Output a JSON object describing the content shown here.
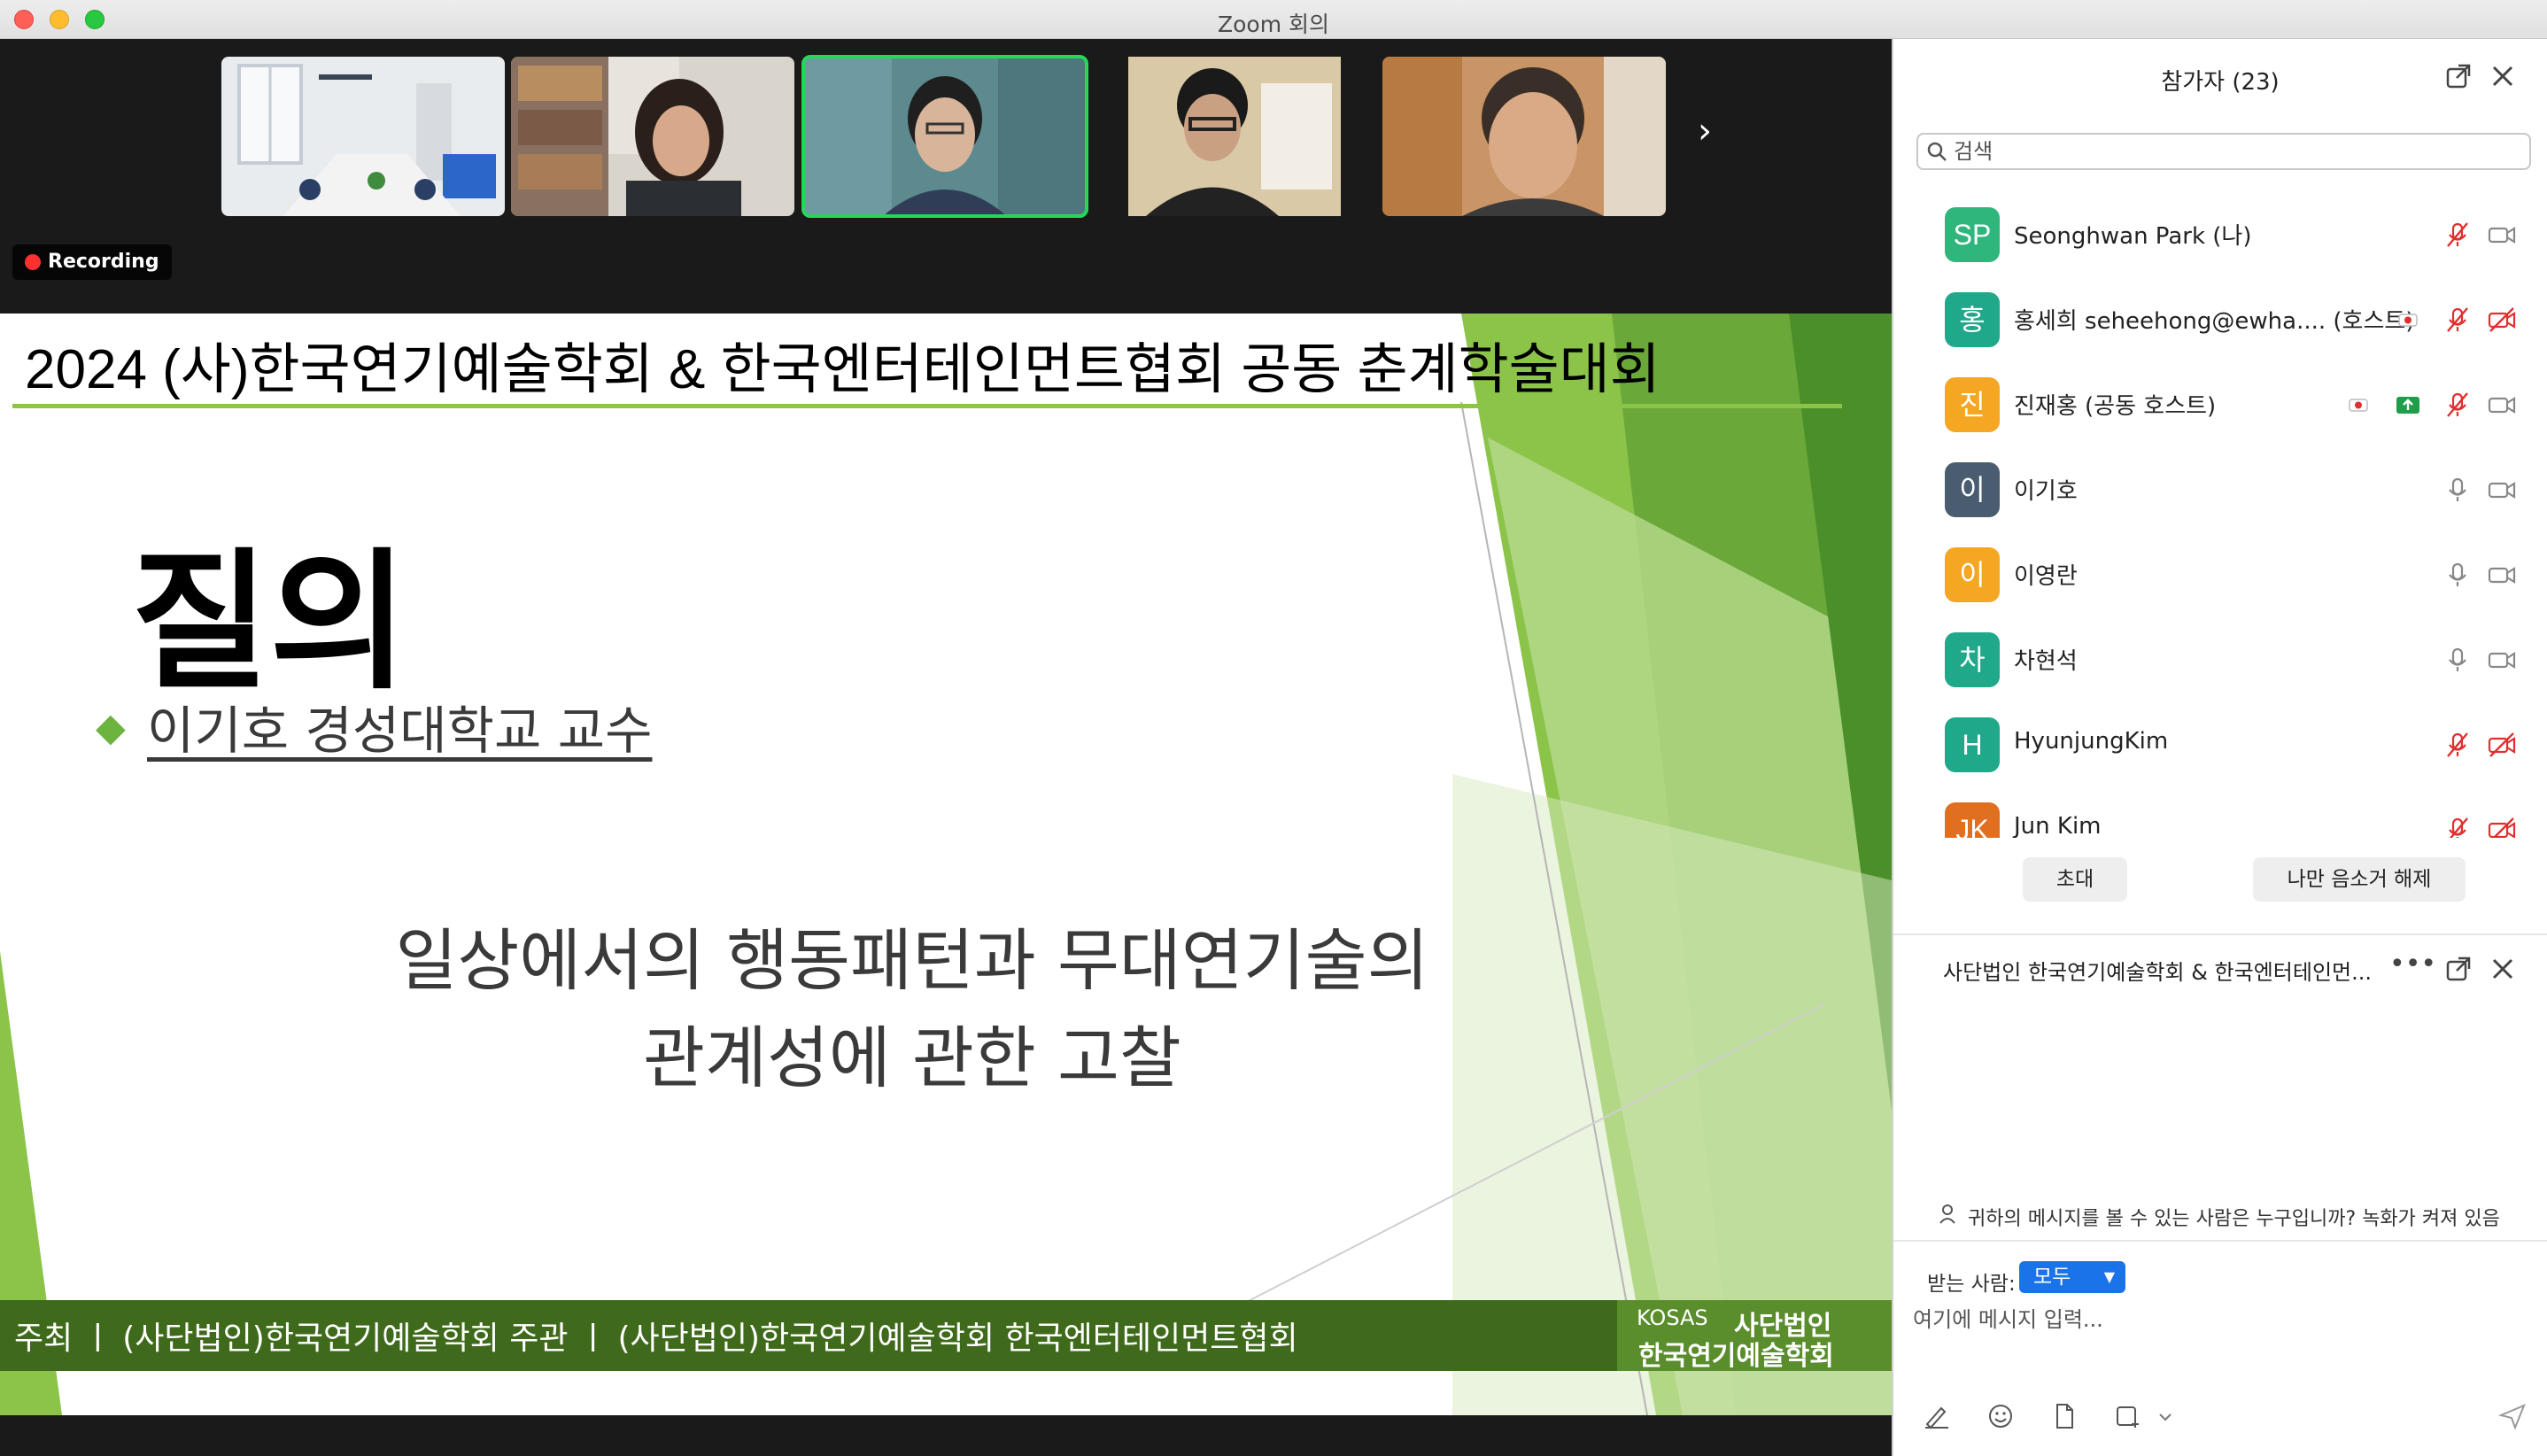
{
  "window": {
    "title": "Zoom 회의"
  },
  "video_strip": {
    "tiles": [
      {
        "name": "room-camera"
      },
      {
        "name": "participant-woman"
      },
      {
        "name": "participant-active-speaker"
      },
      {
        "name": "participant-glasses"
      },
      {
        "name": "participant-man"
      }
    ],
    "next_icon": "chevron-right-icon"
  },
  "recording": {
    "label": "Recording",
    "color": "#ff3030"
  },
  "slide": {
    "header": "2024 (사)한국연기예술학회 & 한국엔터테인먼트협회 공동 춘계학술대회",
    "big_title": "질의",
    "bullet": "◆",
    "presenter": "이기호 경성대학교 교수",
    "topic_line1": "일상에서의 행동패턴과 무대연기술의",
    "topic_line2": "관계성에 관한 고찰",
    "footer": "주최 ㅣ (사단법인)한국연기예술학회   주관 ㅣ (사단법인)한국연기예술학회   한국엔터테인먼트협회",
    "logo_small": "KOSAS",
    "logo_line1": "사단법인",
    "logo_line2": "한국연기예술학회",
    "accent": "#8cc44a"
  },
  "participants_panel": {
    "title": "참가자 (23)",
    "search_placeholder": "검색",
    "participants": [
      {
        "initials": "SP",
        "name": "Seonghwan Park (나)",
        "color": "#2eb67d",
        "mic": "muted",
        "video": "on"
      },
      {
        "initials": "홍",
        "name": "홍세희 seheehong@ewha....  (호스트)",
        "color": "#1fa88a",
        "mic": "muted",
        "video": "off",
        "recording": true
      },
      {
        "initials": "진",
        "name": "진재홍 (공동 호스트)",
        "color": "#f5a623",
        "mic": "muted",
        "video": "on",
        "recording": true,
        "sharing": true
      },
      {
        "initials": "이",
        "name": "이기호",
        "color": "#4a5d70",
        "mic": "on",
        "video": "on"
      },
      {
        "initials": "이",
        "name": "이영란",
        "color": "#f5a623",
        "mic": "on",
        "video": "on"
      },
      {
        "initials": "차",
        "name": "차현석",
        "color": "#1fa88a",
        "mic": "on",
        "video": "on"
      },
      {
        "initials": "H",
        "name": "HyunjungKim",
        "color": "#1fa88a",
        "mic": "muted",
        "video": "off"
      },
      {
        "initials": "JK",
        "name": "Jun Kim",
        "color": "#e07020",
        "mic": "muted",
        "video": "off"
      }
    ],
    "invite_label": "초대",
    "unmute_me_label": "나만 음소거 해제"
  },
  "chat_panel": {
    "title": "사단법인 한국연기예술학회 & 한국엔터테인먼...",
    "notice": "귀하의 메시지를 볼 수 있는 사람은 누구입니까? 녹화가 켜져 있음",
    "to_label": "받는 사람:",
    "to_value": "모두",
    "input_placeholder": "여기에 메시지 입력...",
    "accent": "#1a73e8"
  }
}
